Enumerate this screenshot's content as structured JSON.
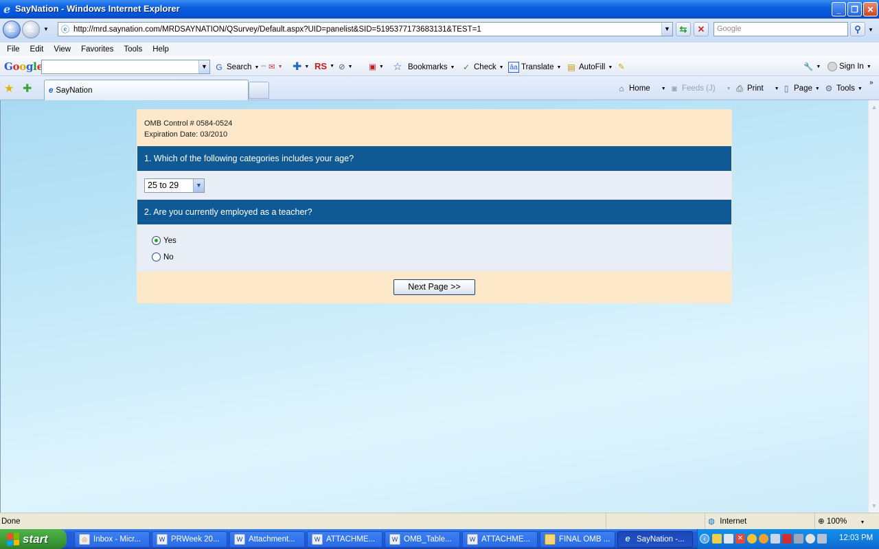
{
  "window": {
    "title": "SayNation - Windows Internet Explorer",
    "controls": [
      "minimize",
      "restore",
      "close"
    ]
  },
  "address_bar": {
    "url": "http://mrd.saynation.com/MRDSAYNATION/QSurvey/Default.aspx?UID=panelist&SID=5195377173683131&TEST=1",
    "search_placeholder": "Google"
  },
  "menu": [
    "File",
    "Edit",
    "View",
    "Favorites",
    "Tools",
    "Help"
  ],
  "google_toolbar": {
    "logo": "Google",
    "search_label": "Search",
    "bookmarks_label": "Bookmarks",
    "check_label": "Check",
    "translate_label": "Translate",
    "autofill_label": "AutoFill",
    "signin_label": "Sign In"
  },
  "tabs": [
    {
      "label": "SayNation",
      "active": true
    }
  ],
  "command_bar": {
    "home": "Home",
    "feeds": "Feeds (J)",
    "print": "Print",
    "page": "Page",
    "tools": "Tools"
  },
  "survey": {
    "omb_control": "OMB Control # 0584-0524",
    "expiration": "Expiration Date: 03/2010",
    "question1": "1.  Which of the following categories includes your age?",
    "q1_selected": "25 to 29",
    "question2": "2.  Are you currently employed as a teacher?",
    "q2_options": [
      {
        "label": "Yes",
        "selected": true
      },
      {
        "label": "No",
        "selected": false
      }
    ],
    "next_button": "Next Page >>"
  },
  "status_bar": {
    "status": "Done",
    "zone": "Internet",
    "zoom": "100%"
  },
  "taskbar": {
    "start": "start",
    "tasks": [
      {
        "label": "Inbox - Micr...",
        "icon": "outlook-icon"
      },
      {
        "label": "PRWeek 20...",
        "icon": "word-doc-icon"
      },
      {
        "label": "Attachment...",
        "icon": "word-doc-icon"
      },
      {
        "label": "ATTACHME...",
        "icon": "word-doc-icon"
      },
      {
        "label": "OMB_Table...",
        "icon": "word-doc-icon"
      },
      {
        "label": "ATTACHME...",
        "icon": "word-doc-icon"
      },
      {
        "label": "FINAL OMB ...",
        "icon": "folder-icon"
      },
      {
        "label": "SayNation -...",
        "icon": "ie-icon",
        "active": true
      }
    ],
    "clock": "12:03 PM"
  },
  "colors": {
    "question_header": "#0f5a95",
    "cream_panel": "#fde9c9",
    "question_body": "#e9edf6"
  }
}
